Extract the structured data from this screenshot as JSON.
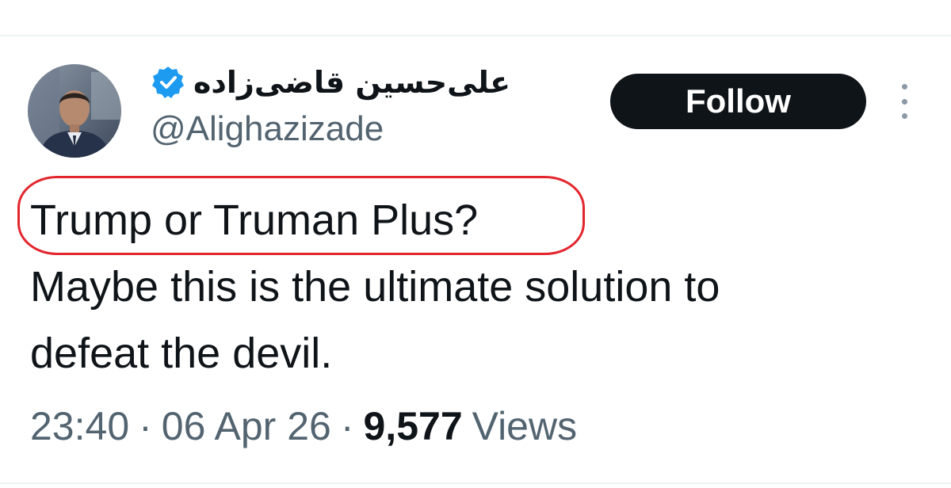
{
  "author": {
    "display_name": "علی‌حسین قاضی‌زاده",
    "handle": "@Alighazizade",
    "verified_icon": "verified-badge-icon",
    "verified_color": "#1d9bf0"
  },
  "actions": {
    "follow_label": "Follow",
    "more_icon": "more-vertical-icon"
  },
  "tweet": {
    "lines": [
      "Trump or Truman Plus?",
      "Maybe this is the ultimate solution to",
      "defeat the devil."
    ],
    "highlight_color": "#e3262e"
  },
  "meta": {
    "time": "23:40",
    "separator": "·",
    "date": "06 Apr 26",
    "views_count": "9,577",
    "views_label": "Views"
  }
}
